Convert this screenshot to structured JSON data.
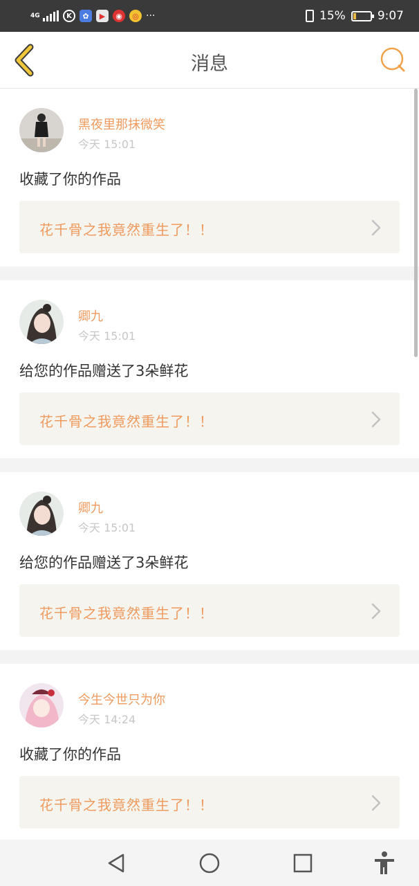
{
  "status_bar": {
    "network": "4G",
    "apps": [
      "k-icon",
      "paw-icon",
      "app-icon",
      "target-icon",
      "weibo-icon"
    ],
    "more": "···",
    "battery_percent": "15%",
    "battery_level": 0.15,
    "time": "9:07"
  },
  "header": {
    "title": "消息",
    "accent": "#f0a24b"
  },
  "messages": [
    {
      "user": "黑夜里那抹微笑",
      "time": "今天 15:01",
      "action": "收藏了你的作品",
      "work": "花千骨之我竟然重生了！！"
    },
    {
      "user": "卿九",
      "time": "今天 15:01",
      "action": "给您的作品赠送了3朵鲜花",
      "work": "花千骨之我竟然重生了！！"
    },
    {
      "user": "卿九",
      "time": "今天 15:01",
      "action": "给您的作品赠送了3朵鲜花",
      "work": "花千骨之我竟然重生了！！"
    },
    {
      "user": "今生今世只为你",
      "time": "今天 14:24",
      "action": "收藏了你的作品",
      "work": "花千骨之我竟然重生了！！"
    }
  ],
  "nav_bar": [
    "back-triangle-icon",
    "home-circle-icon",
    "recents-square-icon",
    "accessibility-icon"
  ]
}
